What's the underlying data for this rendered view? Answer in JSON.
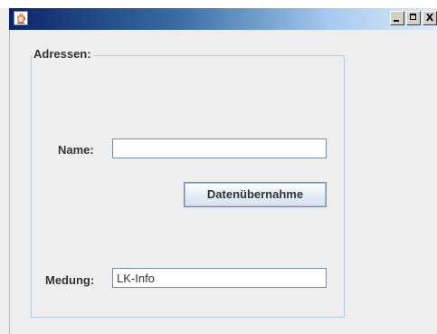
{
  "window": {
    "icon": "java-cup-icon",
    "controls": {
      "minimize_icon": "minimize-icon",
      "maximize_icon": "maximize-icon",
      "close_icon": "close-icon",
      "close_glyph": "X"
    }
  },
  "form": {
    "group_title": "Adressen:",
    "name_label": "Name:",
    "name_value": "",
    "submit_label": "Datenübernahme",
    "meldung_label": "Medung:",
    "meldung_value": "LK-Info"
  },
  "colors": {
    "titlebar_start": "#0a246a",
    "titlebar_end": "#dfe9f5",
    "panel_background": "#eeeeee",
    "group_border": "#b8cfe5"
  }
}
